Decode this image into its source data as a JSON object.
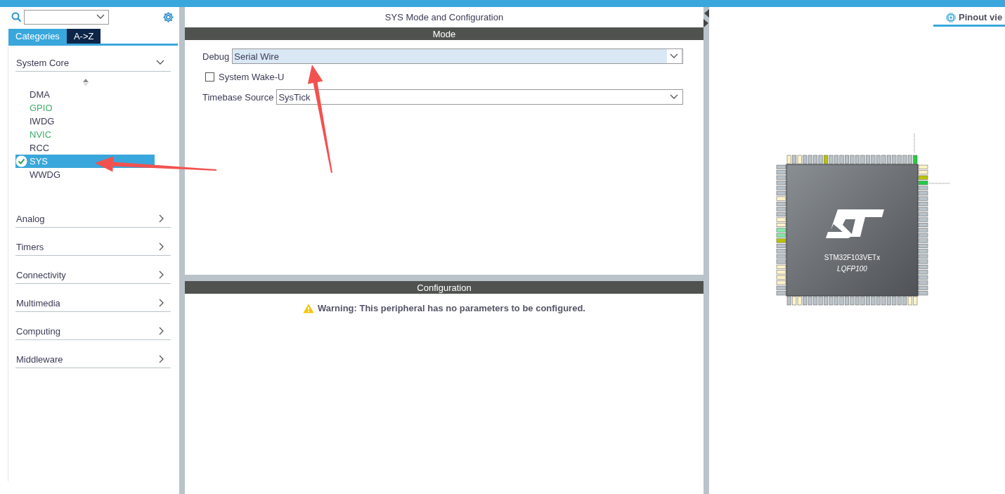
{
  "sidebar": {
    "tabs": [
      {
        "label": "Categories",
        "selected": true
      },
      {
        "label": "A->Z",
        "selected": false
      }
    ],
    "categories": [
      {
        "label": "System Core",
        "expanded": true,
        "items": [
          {
            "label": "DMA",
            "configured": false,
            "checked": false,
            "selected": false
          },
          {
            "label": "GPIO",
            "configured": true,
            "checked": false,
            "selected": false
          },
          {
            "label": "IWDG",
            "configured": false,
            "checked": false,
            "selected": false
          },
          {
            "label": "NVIC",
            "configured": true,
            "checked": false,
            "selected": false
          },
          {
            "label": "RCC",
            "configured": false,
            "checked": false,
            "selected": false
          },
          {
            "label": "SYS",
            "configured": false,
            "checked": true,
            "selected": true
          },
          {
            "label": "WWDG",
            "configured": false,
            "checked": false,
            "selected": false
          }
        ]
      },
      {
        "label": "Analog",
        "expanded": false
      },
      {
        "label": "Timers",
        "expanded": false
      },
      {
        "label": "Connectivity",
        "expanded": false
      },
      {
        "label": "Multimedia",
        "expanded": false
      },
      {
        "label": "Computing",
        "expanded": false
      },
      {
        "label": "Middleware",
        "expanded": false
      }
    ]
  },
  "panel": {
    "title": "SYS Mode and Configuration",
    "mode_header": "Mode",
    "mode_fields": [
      {
        "kind": "select",
        "label": "Debug",
        "value": "Serial Wire",
        "highlighted": true
      },
      {
        "kind": "checkbox",
        "label": "System Wake-U",
        "checked": false
      },
      {
        "kind": "select",
        "label": "Timebase Source",
        "value": "SysTick",
        "highlighted": false
      }
    ],
    "config_header": "Configuration",
    "warning": "Warning: This peripheral has no parameters to be configured."
  },
  "pinout": {
    "tab": {
      "label": "Pinout vie",
      "selected": true
    },
    "chip": {
      "part": "STM32F103VETx",
      "package": "LQFP100"
    }
  },
  "annotations": [
    {
      "kind": "arrow"
    },
    {
      "kind": "arrow"
    }
  ]
}
